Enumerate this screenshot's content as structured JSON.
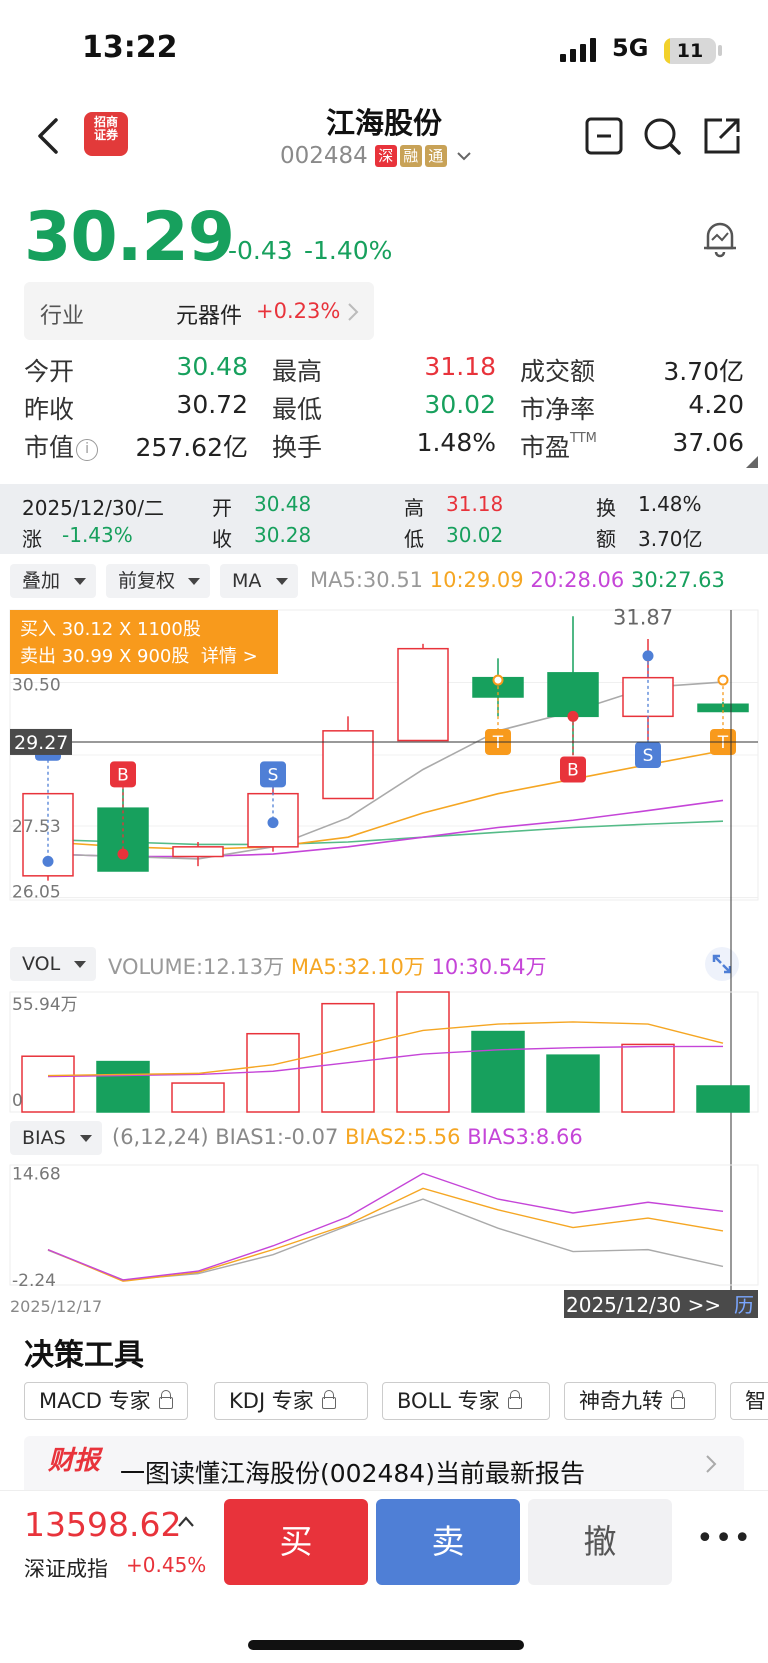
{
  "status_bar": {
    "time": "13:22",
    "network": "5G",
    "battery": "11",
    "battery_level": 0.11
  },
  "header": {
    "stock_name": "江海股份",
    "stock_code": "002484",
    "tags": [
      "深",
      "融",
      "通"
    ],
    "logo_text": "招商证券"
  },
  "quote": {
    "price": "30.29",
    "change": "-0.43",
    "change_pct": "-1.40%",
    "industry_label": "行业",
    "industry_name": "元器件",
    "industry_change": "+0.23%",
    "rows": [
      [
        {
          "label": "今开",
          "value": "30.48",
          "color": "#17a05d"
        },
        {
          "label": "最高",
          "value": "31.18",
          "color": "#e8333b"
        },
        {
          "label": "成交额",
          "value": "3.70亿",
          "color": "#222222"
        }
      ],
      [
        {
          "label": "昨收",
          "value": "30.72",
          "color": "#222222"
        },
        {
          "label": "最低",
          "value": "30.02",
          "color": "#17a05d"
        },
        {
          "label": "市净率",
          "value": "4.20",
          "color": "#222222"
        }
      ],
      [
        {
          "label": "市值",
          "value": "257.62亿",
          "color": "#222222"
        },
        {
          "label": "换手",
          "value": "1.48%",
          "color": "#222222"
        },
        {
          "label": "市盈",
          "value": "37.06",
          "color": "#222222",
          "sup": "TTM"
        }
      ]
    ]
  },
  "crosshair": {
    "date": "2025/12/30/二",
    "open_label": "开",
    "open": "30.48",
    "high_label": "高",
    "high": "31.18",
    "turnover_label": "换",
    "turnover": "1.48%",
    "chg_label": "涨",
    "chg": "-1.43%",
    "close_label": "收",
    "close": "30.28",
    "low_label": "低",
    "low": "30.02",
    "amount_label": "额",
    "amount": "3.70亿"
  },
  "kline_controls": {
    "overlay": "叠加",
    "adjust": "前复权",
    "indicator": "MA",
    "ma5": "MA5:30.51",
    "ma10": "10:29.09",
    "ma20": "20:28.06",
    "ma30": "30:27.63",
    "colors": {
      "ma5": "#aaaaaa",
      "ma10": "#f5a623",
      "ma20": "#c545d8",
      "ma30": "#55bb88"
    }
  },
  "order_tooltip": {
    "buy": "买入 30.12 X 1100股",
    "sell": "卖出 30.99 X 900股",
    "detail": "详情 >"
  },
  "kline": {
    "axis_labels": [
      "30.50",
      "27.53",
      "26.05"
    ],
    "crosshair_price": "29.27",
    "peak_label": "31.87"
  },
  "volume_controls": {
    "indicator": "VOL",
    "volume": "VOLUME:12.13万",
    "ma5": "MA5:32.10万",
    "ma10": "10:30.54万",
    "axis_top": "55.94万",
    "axis_zero": "0"
  },
  "bias_controls": {
    "indicator": "BIAS",
    "params": "(6,12,24)",
    "bias1": "BIAS1:-0.07",
    "bias2": "BIAS2:5.56",
    "bias3": "BIAS3:8.66",
    "axis_top": "14.68",
    "axis_bottom": "-2.24"
  },
  "timeline": {
    "start": "2025/12/17",
    "current": "2025/12/30 >>",
    "history": "历"
  },
  "chart_data": {
    "type": "candlestick",
    "candles": [
      {
        "o": 26.5,
        "c": 28.2,
        "h": 28.2,
        "l": 26.4,
        "up": true,
        "marker": "S"
      },
      {
        "o": 27.9,
        "c": 26.6,
        "h": 28.3,
        "l": 26.6,
        "up": false,
        "marker": "B"
      },
      {
        "o": 26.9,
        "c": 27.1,
        "h": 27.2,
        "l": 26.7,
        "up": true
      },
      {
        "o": 27.1,
        "c": 28.2,
        "h": 28.4,
        "l": 27.0,
        "up": true,
        "marker": "S"
      },
      {
        "o": 28.1,
        "c": 29.5,
        "h": 29.8,
        "l": 28.1,
        "up": true
      },
      {
        "o": 29.3,
        "c": 31.2,
        "h": 31.3,
        "l": 29.3,
        "up": true
      },
      {
        "o": 30.6,
        "c": 30.2,
        "h": 31.0,
        "l": 29.8,
        "up": false,
        "marker": "T"
      },
      {
        "o": 30.7,
        "c": 29.8,
        "h": 31.87,
        "l": 29.0,
        "up": false,
        "marker": "B"
      },
      {
        "o": 29.8,
        "c": 30.6,
        "h": 31.4,
        "l": 29.3,
        "up": true,
        "marker": "S"
      },
      {
        "o": 30.05,
        "c": 29.9,
        "h": 30.1,
        "l": 29.9,
        "up": false,
        "marker": "T"
      }
    ],
    "ma5": [
      26.95,
      26.9,
      26.85,
      27.1,
      27.7,
      28.7,
      29.5,
      29.9,
      30.4,
      30.51
    ],
    "ma10": [
      27.2,
      27.1,
      27.05,
      27.1,
      27.3,
      27.8,
      28.2,
      28.5,
      28.8,
      29.09
    ],
    "ma20": [
      26.95,
      26.9,
      26.9,
      26.95,
      27.1,
      27.3,
      27.5,
      27.65,
      27.85,
      28.06
    ],
    "ma30": [
      27.25,
      27.2,
      27.15,
      27.15,
      27.2,
      27.3,
      27.4,
      27.5,
      27.57,
      27.63
    ],
    "volume": [
      26,
      23.5,
      13.5,
      36.5,
      50.5,
      55.94,
      37.5,
      26.5,
      31.5,
      12.13
    ],
    "volume_up": [
      true,
      false,
      true,
      true,
      true,
      true,
      false,
      false,
      true,
      false
    ],
    "vol_ma5": [
      17,
      17.5,
      18,
      22,
      30,
      38,
      41,
      42,
      41,
      32.1
    ],
    "vol_ma10": [
      16.5,
      17,
      17.5,
      19,
      23,
      27,
      29,
      30,
      30.5,
      30.54
    ],
    "bias1": [
      2.5,
      -2.2,
      -1.2,
      1.8,
      6.4,
      10.6,
      6.0,
      2.3,
      2.6,
      -0.07
    ],
    "bias2": [
      2.6,
      -2.4,
      -1.0,
      2.6,
      6.6,
      12.3,
      8.9,
      6.1,
      7.6,
      5.56
    ],
    "bias3": [
      2.6,
      -2.2,
      -0.8,
      3.2,
      7.8,
      14.68,
      10.6,
      8.4,
      10.1,
      8.66
    ]
  },
  "tools": {
    "title": "决策工具",
    "buttons": [
      "MACD 专家",
      "KDJ 专家",
      "BOLL 专家",
      "神奇九转",
      "智"
    ]
  },
  "report": {
    "badge": "财报",
    "text": "一图读懂江海股份(002484)当前最新报告"
  },
  "bottom": {
    "index_value": "13598.62",
    "index_name": "深证成指",
    "index_change": "+0.45%",
    "buy": "买",
    "sell": "卖",
    "cancel": "撤",
    "more": "•••"
  }
}
